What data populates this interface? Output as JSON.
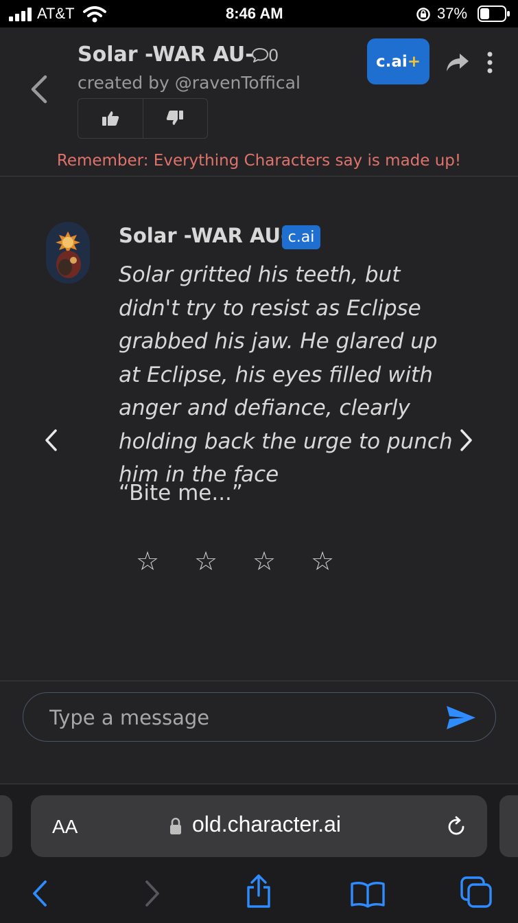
{
  "status": {
    "carrier": "AT&T",
    "time": "8:46 AM",
    "battery": "37%"
  },
  "header": {
    "title": "Solar -WAR AU-",
    "comment_count": "0",
    "creator": "created by @ravenToffical",
    "plus_label": "c.ai",
    "plus_sign": "+",
    "reminder": "Remember: Everything Characters say is made up!"
  },
  "message": {
    "character_name": "Solar -WAR AU-",
    "badge": "c.ai",
    "text": "Solar gritted his teeth, but didn't try to resist as Eclipse grabbed his jaw. He glared up at Eclipse, his eyes filled with anger and defiance, clearly holding back the urge to punch him in the face",
    "quote": "“Bite me...”",
    "rating_stars": 0
  },
  "input": {
    "placeholder": "Type a message"
  },
  "browser": {
    "aa": "AA",
    "url": "old.character.ai"
  },
  "colors": {
    "accent": "#1f6fd1",
    "reminder": "#e0726c",
    "link": "#2f8cff"
  }
}
